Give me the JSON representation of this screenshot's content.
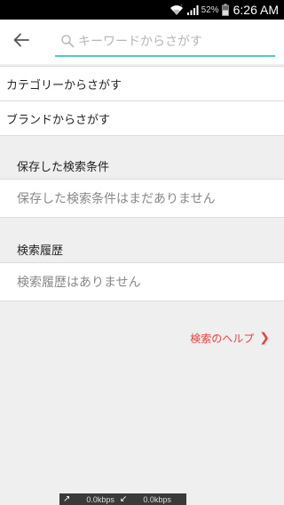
{
  "status_bar": {
    "battery_percent": "52%",
    "time": "6:26 AM"
  },
  "search": {
    "placeholder": "キーワードからさがす"
  },
  "nav": {
    "category_label": "カテゴリーからさがす",
    "brand_label": "ブランドからさがす"
  },
  "saved_searches": {
    "title": "保存した検索条件",
    "empty_message": "保存した検索条件はまだありません"
  },
  "history": {
    "title": "検索履歴",
    "empty_message": "検索履歴はありません"
  },
  "help": {
    "label": "検索のヘルプ",
    "chevron": "❯"
  },
  "net_overlay": {
    "up_arrow": "↗",
    "up_value": "0.0kbps",
    "down_arrow": "↙",
    "down_value": "0.0kbps"
  },
  "colors": {
    "accent": "#56c9bf",
    "link": "#e5433c"
  },
  "icons": {
    "back": "back-arrow-icon",
    "search": "search-icon",
    "wifi": "wifi-icon",
    "signal": "signal-icon",
    "battery": "battery-icon"
  }
}
